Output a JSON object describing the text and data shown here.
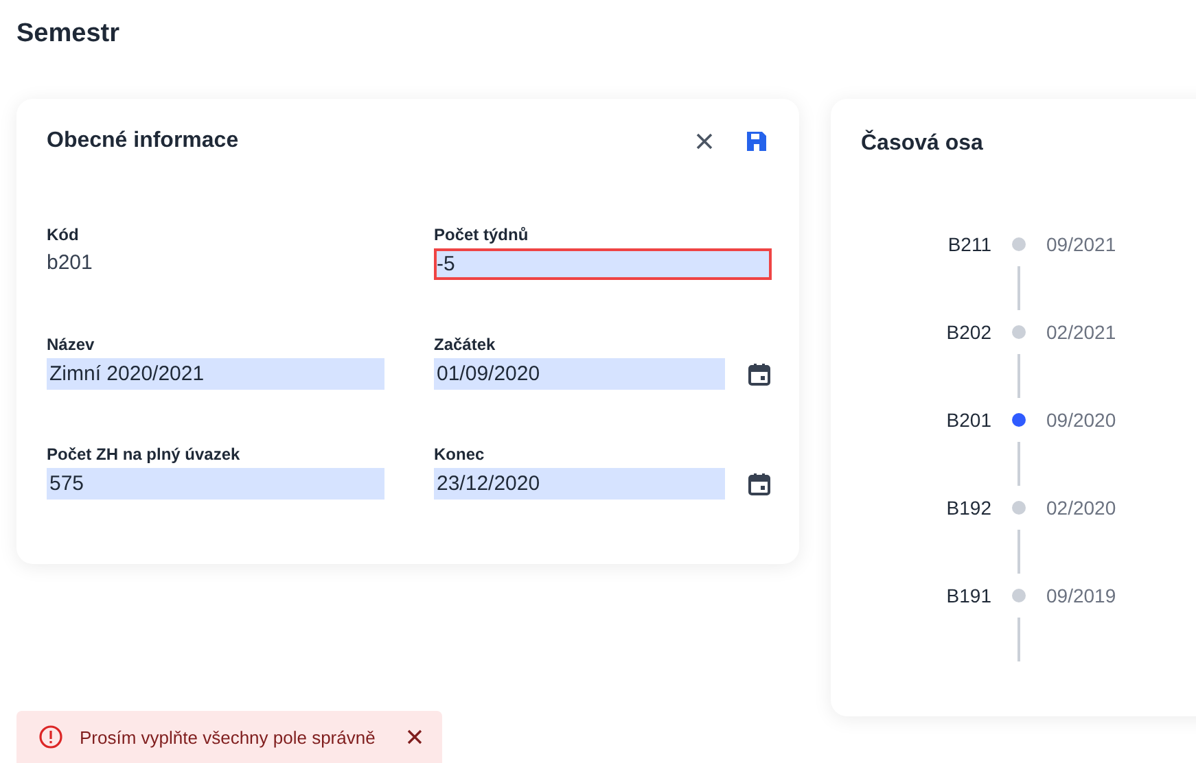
{
  "page_title": "Semestr",
  "form_card": {
    "title": "Obecné informace",
    "fields": [
      {
        "kind": "text",
        "label": "Kód",
        "value": "b201"
      },
      {
        "kind": "input",
        "label": "Počet týdnů",
        "value": "-5",
        "invalid": true
      },
      {
        "kind": "input",
        "label": "Název",
        "value": "Zimní 2020/2021",
        "invalid": false
      },
      {
        "kind": "date",
        "label": "Začátek",
        "value": "01/09/2020",
        "invalid": false
      },
      {
        "kind": "input",
        "label": "Počet ZH na plný úvazek",
        "value": "575",
        "invalid": false
      },
      {
        "kind": "date",
        "label": "Konec",
        "value": "23/12/2020",
        "invalid": false
      }
    ]
  },
  "timeline_card": {
    "title": "Časová osa",
    "items": [
      {
        "code": "B211",
        "date": "09/2021",
        "selected": false
      },
      {
        "code": "B202",
        "date": "02/2021",
        "selected": false
      },
      {
        "code": "B201",
        "date": "09/2020",
        "selected": true
      },
      {
        "code": "B192",
        "date": "02/2020",
        "selected": false
      },
      {
        "code": "B191",
        "date": "09/2019",
        "selected": false
      }
    ]
  },
  "toast": {
    "message": "Prosím vyplňte všechny pole správně"
  }
}
